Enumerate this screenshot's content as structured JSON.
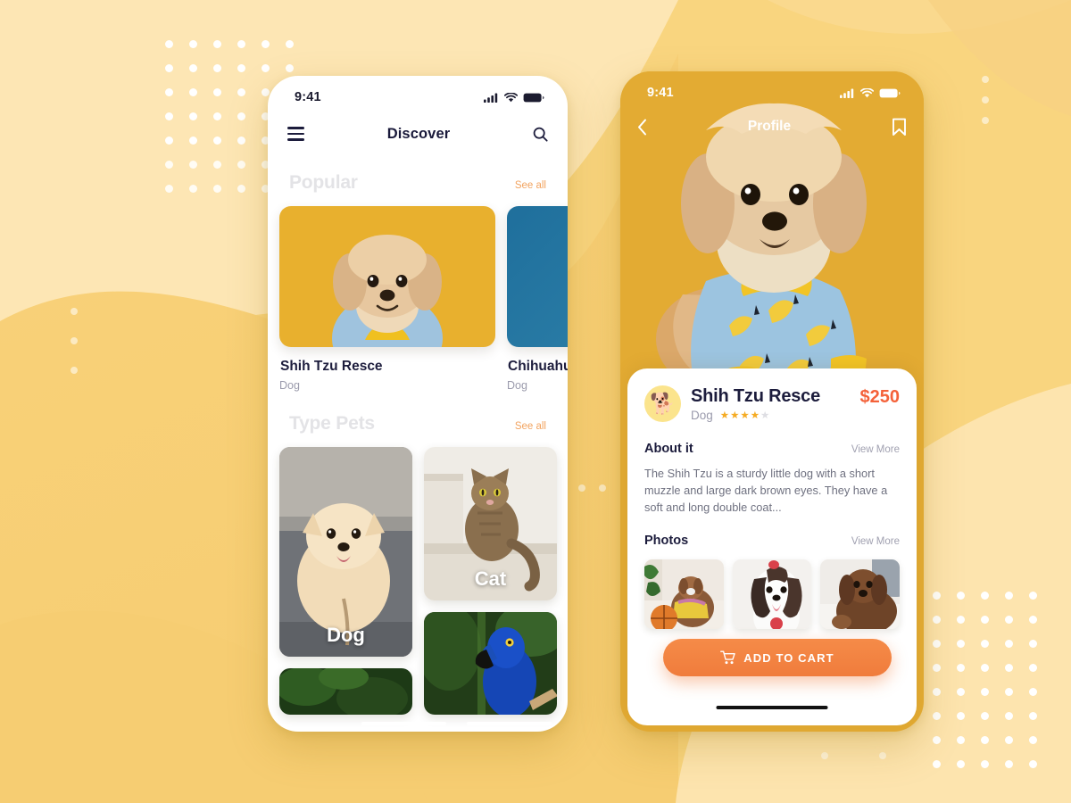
{
  "theme": {
    "background": "#f8d57e",
    "accent_orange": "#f07c3c",
    "see_all_orange": "#f2a35f",
    "price_red": "#f4623a",
    "star_gold": "#f5ab23",
    "dark_navy": "#1c1c3c"
  },
  "left_phone": {
    "status": {
      "time": "9:41",
      "cellular_icon": "signal-bars-icon",
      "wifi_icon": "wifi-icon",
      "battery_icon": "battery-icon"
    },
    "nav": {
      "menu_icon": "hamburger-menu-icon",
      "title": "Discover",
      "search_icon": "search-icon"
    },
    "sections": [
      {
        "title": "Popular",
        "see_all": "See all",
        "cards": [
          {
            "name": "Shih Tzu Resce",
            "type": "Dog",
            "image": "shih-tzu-yellow-backdrop-photo"
          },
          {
            "name": "Chihuahua",
            "type": "Dog",
            "image": "blue-gradient-photo"
          }
        ]
      },
      {
        "title": "Type Pets",
        "see_all": "See all",
        "cards": [
          {
            "label": "Dog",
            "image": "pomeranian-on-stairs-photo"
          },
          {
            "label": "Cat",
            "image": "tabby-cat-on-steps-photo"
          },
          {
            "label": "",
            "image": "blue-macaw-parrot-photo"
          },
          {
            "label": "",
            "image": "green-foliage-photo"
          }
        ]
      }
    ],
    "home_indicator": "home-indicator-bar"
  },
  "right_phone": {
    "status": {
      "time": "9:41",
      "cellular_icon": "signal-bars-icon",
      "wifi_icon": "wifi-icon",
      "battery_icon": "battery-icon"
    },
    "nav": {
      "back_icon": "chevron-left-icon",
      "title": "Profile",
      "bookmark_icon": "bookmark-icon"
    },
    "hero_image": "shih-tzu-banana-pajamas-photo",
    "pet": {
      "avatar_icon": "dog-face-emoji",
      "name": "Shih Tzu Resce",
      "type": "Dog",
      "rating": 4,
      "rating_max": 5,
      "price": "$250"
    },
    "about": {
      "title": "About it",
      "view_more": "View More",
      "text": "The Shih Tzu is a sturdy little dog with a short muzzle and large dark brown eyes. They have a soft and long double coat..."
    },
    "photos": {
      "title": "Photos",
      "view_more": "View More",
      "items": [
        {
          "image": "dog-with-basketball-photo"
        },
        {
          "image": "shih-tzu-tongue-out-photo"
        },
        {
          "image": "brown-poodle-on-bed-photo"
        }
      ]
    },
    "cta": {
      "icon": "shopping-cart-icon",
      "label": "ADD TO CART"
    },
    "home_indicator": "home-indicator-bar"
  }
}
